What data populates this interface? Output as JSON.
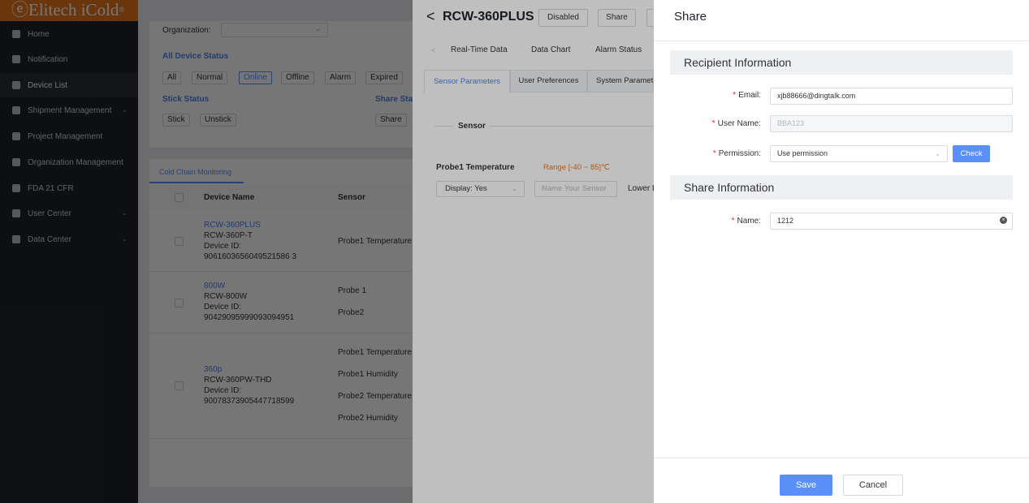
{
  "brand": {
    "name": "Elitech iCold",
    "reg": "®"
  },
  "sidebar": {
    "items": [
      {
        "label": "Home",
        "icon": "home-icon"
      },
      {
        "label": "Notification",
        "icon": "message-icon"
      },
      {
        "label": "Device List",
        "icon": "device-icon",
        "active": true
      },
      {
        "label": "Shipment Management",
        "icon": "shipment-icon",
        "expand": true
      },
      {
        "label": "Project Management",
        "icon": "project-icon"
      },
      {
        "label": "Organization Management",
        "icon": "organization-icon"
      },
      {
        "label": "FDA 21 CFR",
        "icon": "shield-icon"
      },
      {
        "label": "User Center",
        "icon": "user-icon",
        "expand": true
      },
      {
        "label": "Data Center",
        "icon": "data-icon",
        "expand": true
      }
    ]
  },
  "filters": {
    "organization_label": "Organization:",
    "device_status_title": "All Device Status",
    "device_status_chips": [
      "All",
      "Normal",
      "Online",
      "Offline",
      "Alarm",
      "Expired"
    ],
    "selected_status": "Online",
    "stick_status_title": "Stick Status",
    "stick_chips": [
      "Stick",
      "Unstick"
    ],
    "share_status_title": "Share Sta",
    "share_chips": [
      "Share"
    ]
  },
  "table": {
    "tab": "Cold Chain Monitoring",
    "headers": [
      "Device Name",
      "Sensor"
    ],
    "rows": [
      {
        "name": "RCW-360PLUS",
        "model": "RCW-360P-T",
        "id_label": "Device ID:",
        "id": "9061603656049521586 3",
        "sensors": [
          "Probe1 Temperature"
        ]
      },
      {
        "name": "800W",
        "model": "RCW-800W",
        "id_label": "Device ID:",
        "id": "90429095999093094951",
        "sensors": [
          "Probe 1",
          "Probe2"
        ]
      },
      {
        "name": "360p",
        "model": "RCW-360PW-THD",
        "id_label": "Device ID:",
        "id": "90078373905447718599",
        "sensors": [
          "Probe1 Temperature",
          "Probe1 Humidity",
          "Probe2 Temperature",
          "Probe2 Humidity"
        ]
      }
    ]
  },
  "device_drawer": {
    "title": "RCW-360PLUS",
    "buttons": [
      "Disabled",
      "Share"
    ],
    "nav_tabs": [
      "Real-Time Data",
      "Data Chart",
      "Alarm Status"
    ],
    "sub_tabs": [
      "Sensor Parameters",
      "User Preferences",
      "System Paramete"
    ],
    "section": "Sensor",
    "probe_label": "Probe1 Temperature",
    "range_label": "Range [-40 ~ 85]℃",
    "display_select": "Display: Yes",
    "sensor_name_placeholder": "Name Your Sensor",
    "lower_label": "Lower L"
  },
  "share": {
    "title": "Share",
    "recipient_section": "Recipient Information",
    "email_label": "Email:",
    "email_value": "xjb88666@dingtalk.com",
    "username_label": "User Name:",
    "username_value": "BBA123",
    "permission_label": "Permission:",
    "permission_value": "Use permission",
    "check_label": "Check",
    "share_section": "Share Information",
    "name_label": "Name:",
    "name_value": "1212",
    "save_label": "Save",
    "cancel_label": "Cancel"
  },
  "colors": {
    "accent": "#5b8ff9",
    "brand": "#e8761e",
    "required": "#f5222d",
    "range": "#e8761e"
  }
}
